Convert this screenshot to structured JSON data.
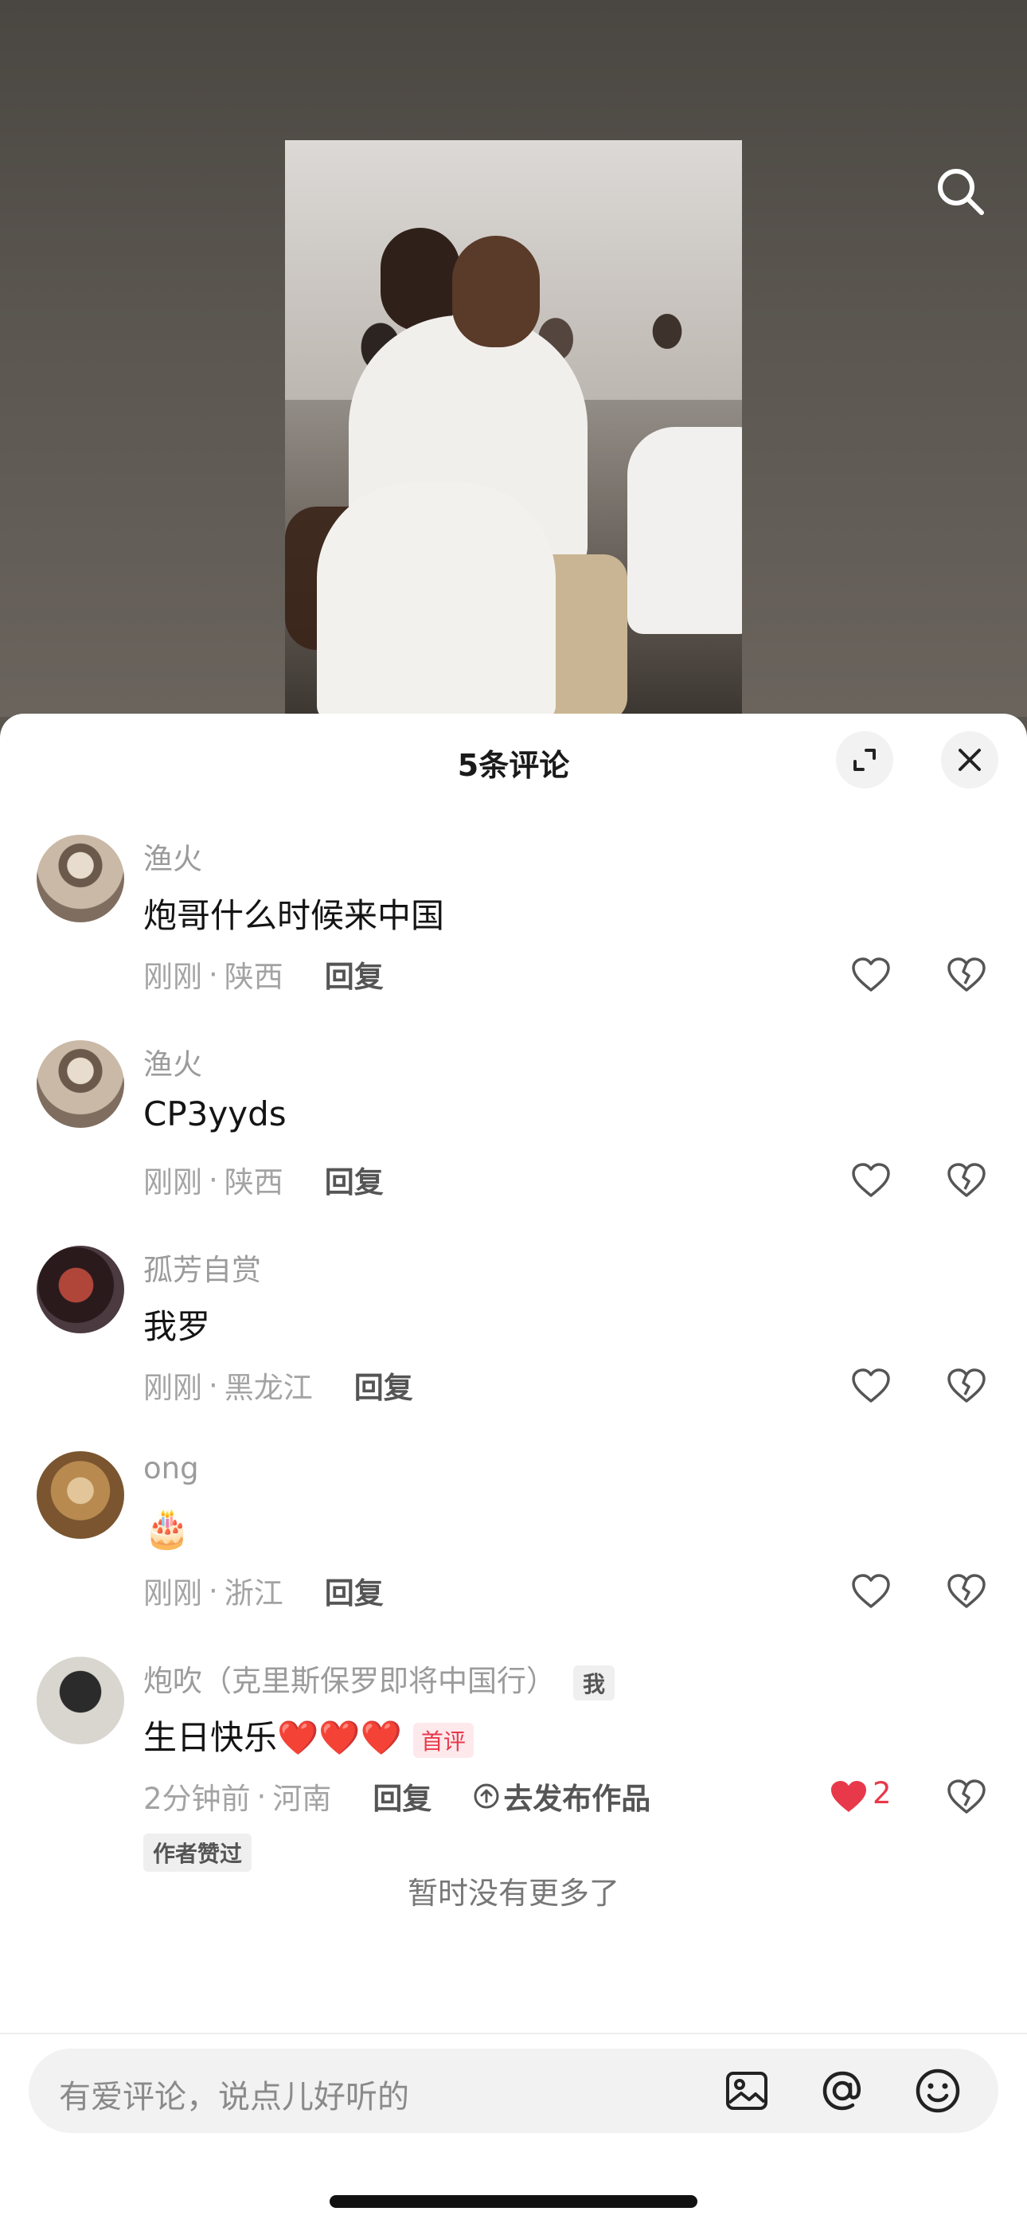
{
  "sheet": {
    "title": "5条评论"
  },
  "comments": [
    {
      "user": "渔火",
      "text": "炮哥什么时候来中国",
      "time": "刚刚",
      "location": "陕西",
      "reply": "回复"
    },
    {
      "user": "渔火",
      "text": "CP3yyds",
      "time": "刚刚",
      "location": "陕西",
      "reply": "回复"
    },
    {
      "user": "孤芳自赏",
      "text": "我罗",
      "time": "刚刚",
      "location": "黑龙江",
      "reply": "回复"
    },
    {
      "user": "ong",
      "text": "🎂",
      "time": "刚刚",
      "location": "浙江",
      "reply": "回复"
    },
    {
      "user": "炮吹（克里斯保罗即将中国行）",
      "me_tag": "我",
      "text": "生日快乐❤️❤️❤️",
      "first_tag": "首评",
      "time": "2分钟前",
      "location": "河南",
      "reply": "回复",
      "publish": "去发布作品",
      "likes": "2",
      "author_tag": "作者赞过"
    }
  ],
  "separator": "·",
  "footer": {
    "no_more": "暂时没有更多了"
  },
  "input": {
    "placeholder": "有爱评论，说点儿好听的"
  },
  "colors": {
    "like_red": "#e8394a",
    "text_primary": "#141414",
    "text_secondary": "#9b9b9b"
  }
}
